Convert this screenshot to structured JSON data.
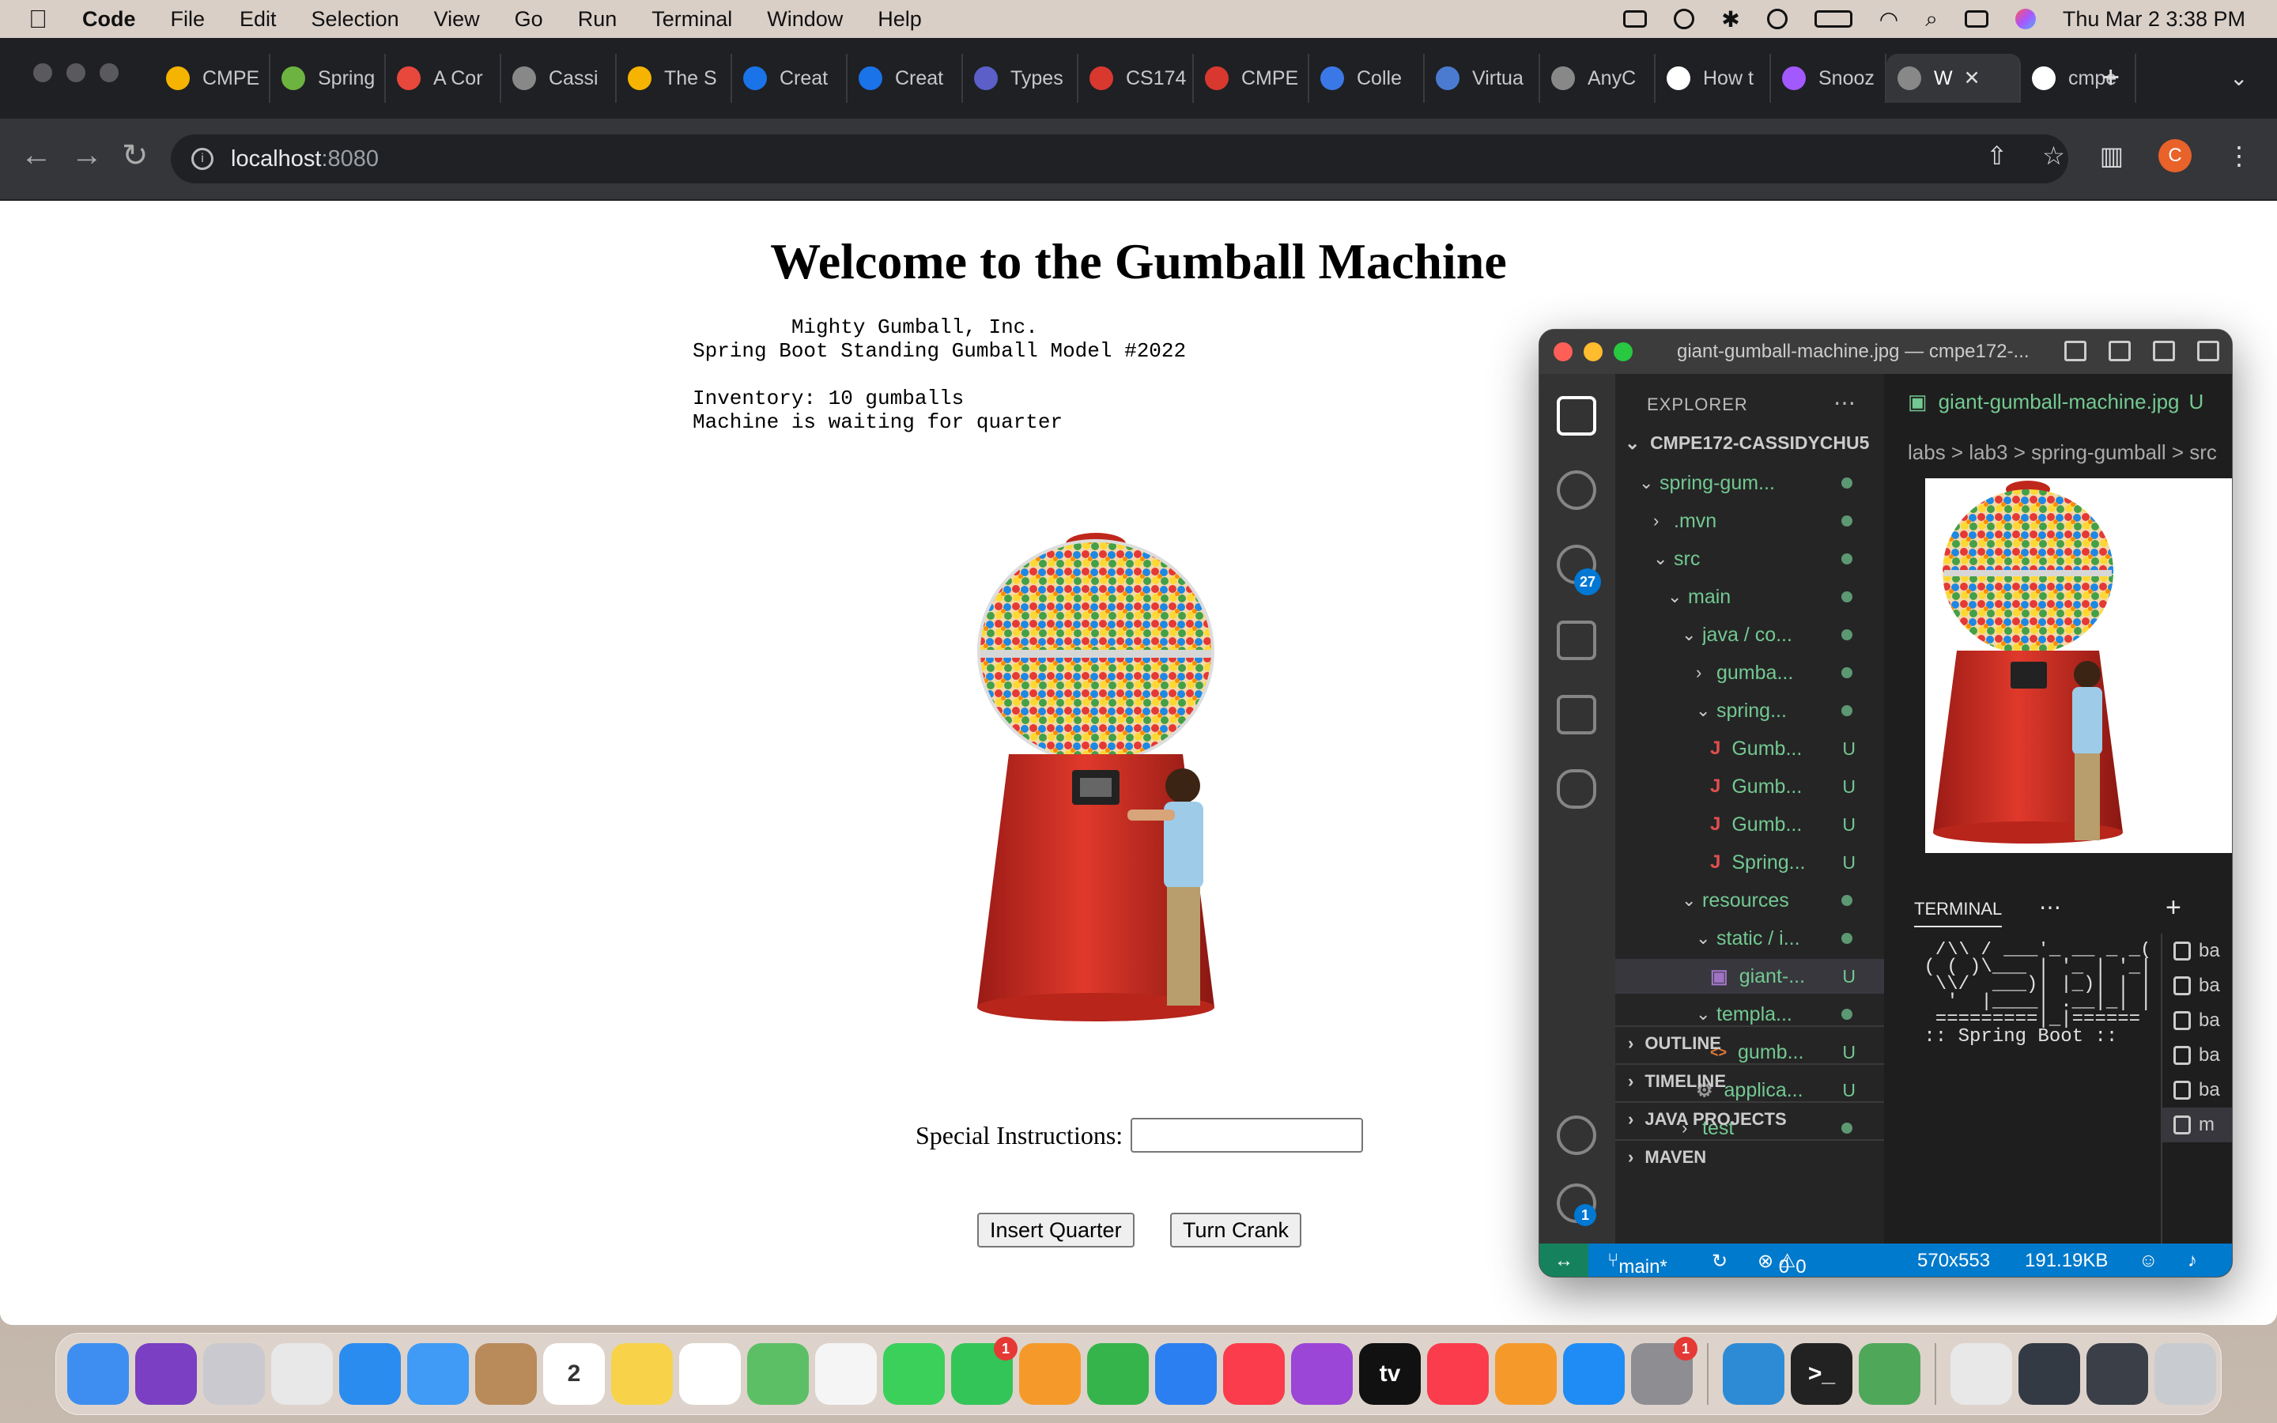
{
  "menubar": {
    "app_name": "Code",
    "items": [
      "File",
      "Edit",
      "Selection",
      "View",
      "Go",
      "Run",
      "Terminal",
      "Window",
      "Help"
    ],
    "clock": "Thu Mar 2  3:38 PM"
  },
  "browser": {
    "tabs": [
      {
        "label": "CMPE",
        "icon": "google-drive-icon",
        "color": "#f4b400"
      },
      {
        "label": "Spring",
        "icon": "spring-icon",
        "color": "#6db33f"
      },
      {
        "label": "A Cor",
        "icon": "asterisk-icon",
        "color": "#e8473c"
      },
      {
        "label": "Cassi",
        "icon": "globe-icon",
        "color": "#888888"
      },
      {
        "label": "The S",
        "icon": "slides-icon",
        "color": "#f6b400"
      },
      {
        "label": "Creat",
        "icon": "c-icon",
        "color": "#1a73e8"
      },
      {
        "label": "Creat",
        "icon": "c-icon",
        "color": "#1a73e8"
      },
      {
        "label": "Types",
        "icon": "ux-icon",
        "color": "#5b5fc7"
      },
      {
        "label": "CS174",
        "icon": "gear-red-icon",
        "color": "#d9382f"
      },
      {
        "label": "CMPE",
        "icon": "gear-red-icon",
        "color": "#d9382f"
      },
      {
        "label": "Colle",
        "icon": "bulb-icon",
        "color": "#3b78e7"
      },
      {
        "label": "Virtua",
        "icon": "vmware-icon",
        "color": "#4a7bd0"
      },
      {
        "label": "AnyC",
        "icon": "globe-icon",
        "color": "#888888"
      },
      {
        "label": "How t",
        "icon": "medium-icon",
        "color": "#ffffff"
      },
      {
        "label": "Snooz",
        "icon": "figma-icon",
        "color": "#a259ff"
      },
      {
        "label": "W",
        "icon": "globe-icon",
        "color": "#888888",
        "active": true
      },
      {
        "label": "cmpe",
        "icon": "github-icon",
        "color": "#ffffff"
      }
    ],
    "url_host": "localhost",
    "url_port": ":8080",
    "profile_initial": "C"
  },
  "page": {
    "title": "Welcome to the Gumball Machine",
    "status_lines": "        Mighty Gumball, Inc.\nSpring Boot Standing Gumball Model #2022\n\nInventory: 10 gumballs\nMachine is waiting for quarter",
    "special_label": "Special Instructions:",
    "special_value": "",
    "insert_button": "Insert Quarter",
    "crank_button": "Turn Crank"
  },
  "vscode": {
    "window_title": "giant-gumball-machine.jpg — cmpe172-...",
    "explorer_label": "EXPLORER",
    "project": "CMPE172-CASSIDYCHU5",
    "scm_badge": "27",
    "settings_badge": "1",
    "tree": [
      {
        "label": "spring-gum...",
        "indent": 1,
        "type": "folder-open",
        "status": "dot"
      },
      {
        "label": ".mvn",
        "indent": 2,
        "type": "folder",
        "status": "dot"
      },
      {
        "label": "src",
        "indent": 2,
        "type": "folder-open",
        "status": "dot"
      },
      {
        "label": "main",
        "indent": 3,
        "type": "folder-open",
        "status": "dot"
      },
      {
        "label": "java / co...",
        "indent": 4,
        "type": "folder-open",
        "status": "dot"
      },
      {
        "label": "gumba...",
        "indent": 5,
        "type": "folder",
        "status": "dot"
      },
      {
        "label": "spring...",
        "indent": 5,
        "type": "folder-open",
        "status": "dot"
      },
      {
        "label": "Gumb...",
        "indent": 6,
        "type": "java",
        "status": "U"
      },
      {
        "label": "Gumb...",
        "indent": 6,
        "type": "java",
        "status": "U"
      },
      {
        "label": "Gumb...",
        "indent": 6,
        "type": "java",
        "status": "U"
      },
      {
        "label": "Spring...",
        "indent": 6,
        "type": "java",
        "status": "U"
      },
      {
        "label": "resources",
        "indent": 4,
        "type": "folder-open",
        "status": "dot"
      },
      {
        "label": "static / i...",
        "indent": 5,
        "type": "folder-open",
        "status": "dot"
      },
      {
        "label": "giant-...",
        "indent": 6,
        "type": "image",
        "status": "U",
        "selected": true
      },
      {
        "label": "templa...",
        "indent": 5,
        "type": "folder-open",
        "status": "dot"
      },
      {
        "label": "gumb...",
        "indent": 6,
        "type": "html",
        "status": "U"
      },
      {
        "label": "applica...",
        "indent": 5,
        "type": "gear",
        "status": "U"
      },
      {
        "label": "test",
        "indent": 4,
        "type": "folder",
        "status": "dot"
      }
    ],
    "sections": [
      "OUTLINE",
      "TIMELINE",
      "JAVA PROJECTS",
      "MAVEN"
    ],
    "editor_tab": "giant-gumball-machine.jpg",
    "editor_tab_status": "U",
    "breadcrumbs": "labs  >  lab3  >  spring-gumball  >  src",
    "terminal_label": "TERMINAL",
    "terminal_lines": "  /\\\\ / ___'_ __ _ _(_\n ( ( )\\___ | '_ | '_|\n  \\\\/  ___)| |_)| | |\n   '  |____| .__|_| |\n  =========|_|======\n :: Spring Boot ::",
    "terminal_list": [
      "ba",
      "ba",
      "ba",
      "ba",
      "ba",
      "m"
    ],
    "status": {
      "branch": "main*",
      "errors": "0",
      "warnings": "0",
      "dimensions": "570x553",
      "size": "191.19KB"
    }
  },
  "dock": {
    "apps": [
      {
        "name": "finder",
        "color": "#3d8ef0"
      },
      {
        "name": "siri",
        "color": "#7a3fc2"
      },
      {
        "name": "launchpad",
        "color": "#c9c9cf"
      },
      {
        "name": "chrome",
        "color": "#e8e8e8"
      },
      {
        "name": "safari",
        "color": "#2b8cf0"
      },
      {
        "name": "mail",
        "color": "#3f9bf5"
      },
      {
        "name": "contacts",
        "color": "#b98a5a"
      },
      {
        "name": "calendar",
        "color": "#ffffff",
        "text": "2"
      },
      {
        "name": "notes",
        "color": "#f8d34a"
      },
      {
        "name": "reminders",
        "color": "#ffffff"
      },
      {
        "name": "maps",
        "color": "#5cbf65"
      },
      {
        "name": "photos",
        "color": "#f5f5f5"
      },
      {
        "name": "messages",
        "color": "#3ad05a"
      },
      {
        "name": "facetime",
        "color": "#33c558",
        "badge": "1"
      },
      {
        "name": "freeform",
        "color": "#f59a2a"
      },
      {
        "name": "numbers",
        "color": "#34b44a"
      },
      {
        "name": "keynote",
        "color": "#2c7ff0"
      },
      {
        "name": "music",
        "color": "#fa3c4c"
      },
      {
        "name": "podcasts",
        "color": "#9b46d6"
      },
      {
        "name": "tv",
        "color": "#111111",
        "text": "tv"
      },
      {
        "name": "news",
        "color": "#fa3c4c"
      },
      {
        "name": "books",
        "color": "#f59a2a"
      },
      {
        "name": "app-store",
        "color": "#1f8cf5"
      },
      {
        "name": "system-settings",
        "color": "#8d8d92",
        "badge": "1"
      },
      {
        "name": "vscode",
        "color": "#2d8bd6"
      },
      {
        "name": "terminal",
        "color": "#222222",
        "text": ">_"
      },
      {
        "name": "eclipse-globe",
        "color": "#4fa85a"
      },
      {
        "name": "document",
        "color": "#e8e8e8"
      },
      {
        "name": "window-thumb-1",
        "color": "#333a44"
      },
      {
        "name": "window-thumb-2",
        "color": "#3a3f48"
      },
      {
        "name": "trash",
        "color": "#c8ccd0"
      }
    ]
  }
}
